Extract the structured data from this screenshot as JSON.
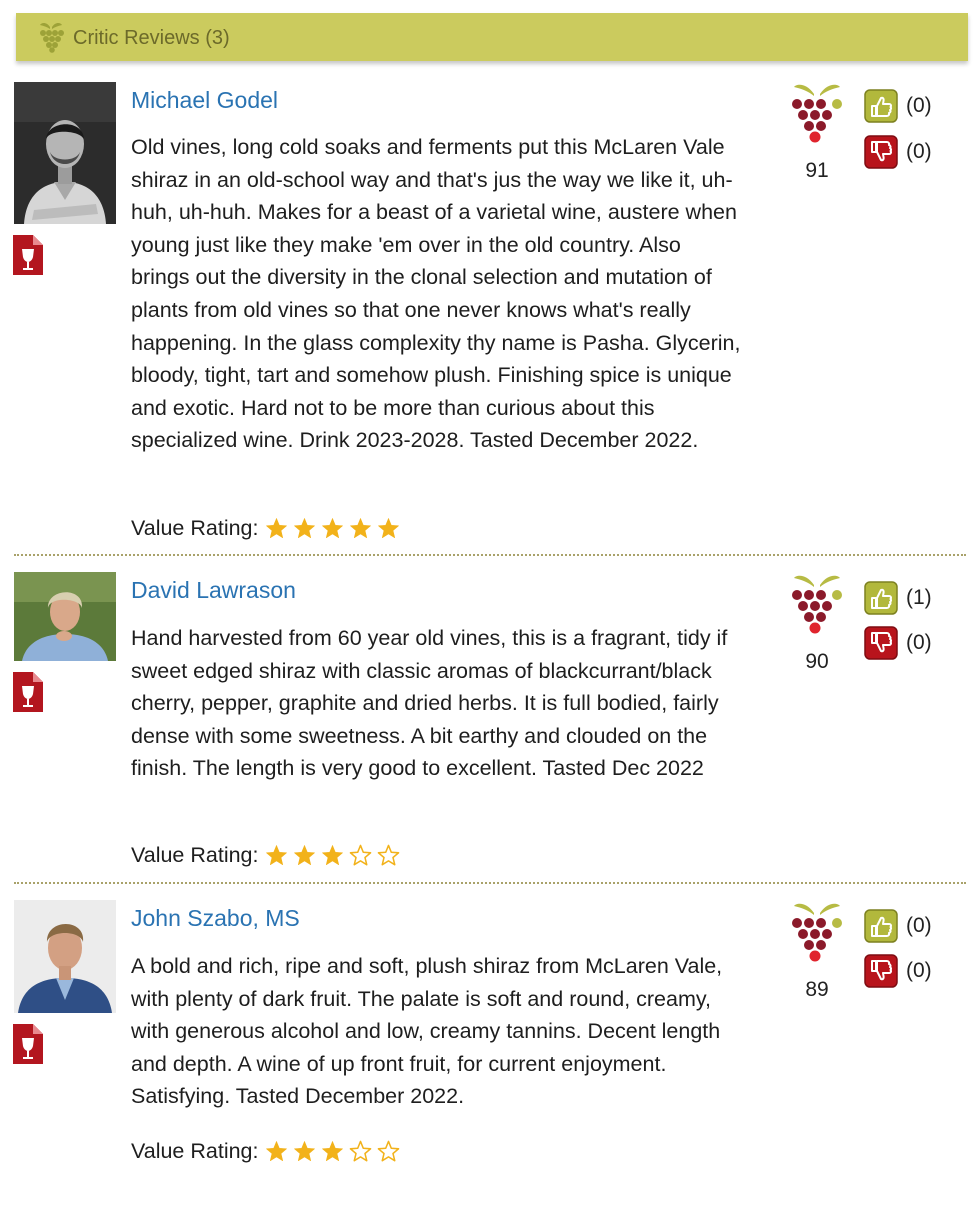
{
  "header": {
    "title": "Critic Reviews (3)",
    "icon": "grape-icon"
  },
  "reviews": [
    {
      "critic": "Michael Godel",
      "text": "Old vines, long cold soaks and ferments put this McLaren Vale shiraz in an old-school way and that's jus the way we like it, uh-huh, uh-huh. Makes for a beast of a varietal wine, austere when young just like they make 'em over in the old country. Also brings out the diversity in the clonal selection and mutation of plants from old vines so that one never knows what's really happening. In the glass complexity thy name is Pasha. Glycerin, bloody, tight, tart and somehow plush. Finishing spice is unique and exotic. Hard not to be more than curious about this specialized wine. Drink 2023-2028. Tasted December 2022.",
      "value_label": "Value Rating:",
      "value_rating": 5,
      "value_rating_max": 5,
      "score": "91",
      "likes": "(0)",
      "dislikes": "(0)"
    },
    {
      "critic": "David Lawrason",
      "text": "Hand harvested from 60 year old vines, this is a fragrant, tidy if sweet edged shiraz with classic aromas of blackcurrant/black cherry, pepper, graphite and dried herbs. It is full bodied, fairly dense with some sweetness. A bit earthy and clouded on the finish. The length is very good to excellent. Tasted Dec 2022",
      "value_label": "Value Rating:",
      "value_rating": 3,
      "value_rating_max": 5,
      "score": "90",
      "likes": "(1)",
      "dislikes": "(0)"
    },
    {
      "critic": "John Szabo, MS",
      "text": "A bold and rich, ripe and soft, plush shiraz from McLaren Vale, with plenty of dark fruit. The palate is soft and round, creamy, with generous alcohol and low, creamy tannins. Decent length and depth. A wine of up front fruit, for current enjoyment. Satisfying. Tasted December 2022.",
      "value_label": "Value Rating:",
      "value_rating": 3,
      "value_rating_max": 5,
      "score": "89",
      "likes": "(0)",
      "dislikes": "(0)"
    }
  ],
  "colors": {
    "header_bg": "#cbcb5e",
    "header_text": "#6c6a2a",
    "link": "#2a73b2",
    "star": "#f2b21a",
    "grape_dark": "#8b1a2a",
    "grape_red": "#e0242d",
    "leaf": "#b7bb44",
    "like_btn": "#b2b83c",
    "dislike_btn": "#b8141c",
    "divider": "#a9a26a"
  },
  "icons": {
    "score": "grape-cluster-icon",
    "pdf": "wine-glass-pdf-icon",
    "like": "thumbs-up-icon",
    "dislike": "thumbs-down-icon",
    "star": "star-icon"
  }
}
